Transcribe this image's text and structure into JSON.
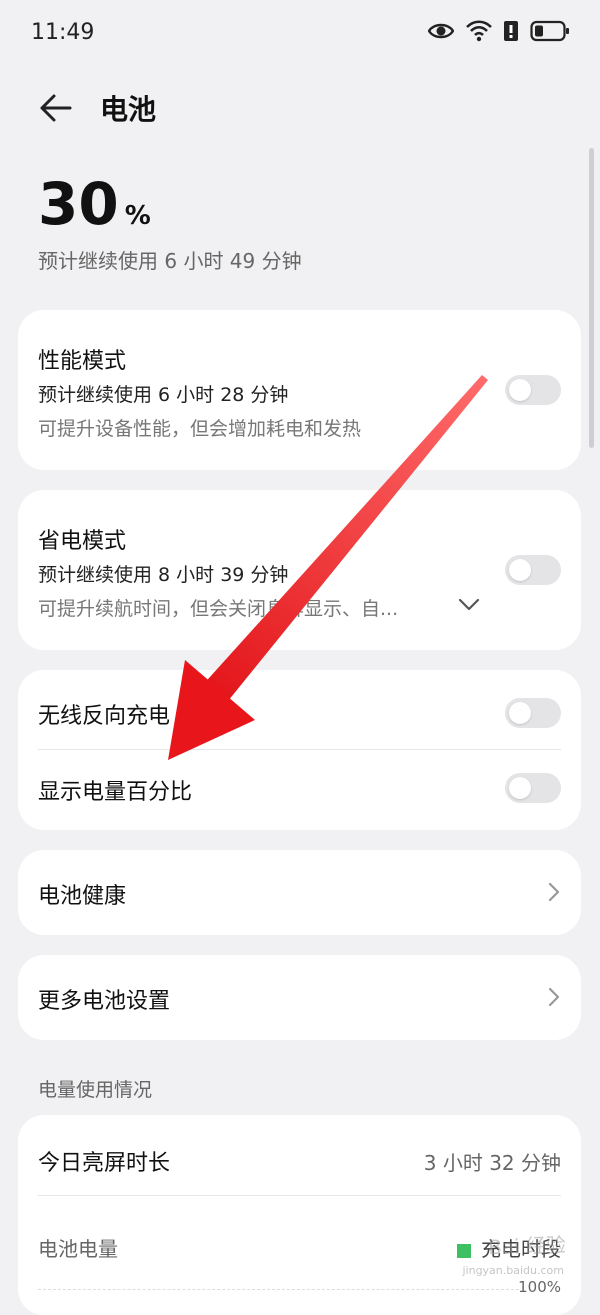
{
  "status_bar": {
    "time": "11:49",
    "icons": [
      "eye-icon",
      "wifi-icon",
      "alert-icon",
      "battery-icon"
    ]
  },
  "header": {
    "title": "电池",
    "back_icon": "arrow-left-icon"
  },
  "battery": {
    "percent": "30",
    "unit": "%",
    "estimate": "预计继续使用 6 小时 49 分钟"
  },
  "performance_mode": {
    "title": "性能模式",
    "estimate": "预计继续使用 6 小时 28 分钟",
    "desc": "可提升设备性能，但会增加耗电和发热",
    "enabled": false
  },
  "power_saving": {
    "title": "省电模式",
    "estimate": "预计继续使用 8 小时 39 分钟",
    "desc": "可提升续航时间，但会关闭息屏显示、自...",
    "enabled": false
  },
  "toggles": {
    "wireless_reverse": {
      "label": "无线反向充电",
      "enabled": false
    },
    "show_percent": {
      "label": "显示电量百分比",
      "enabled": false
    }
  },
  "links": {
    "battery_health": "电池健康",
    "more_settings": "更多电池设置"
  },
  "usage": {
    "section_label": "电量使用情况",
    "screen_time_label": "今日亮屏时长",
    "screen_time_value": "3 小时 32 分钟",
    "battery_level_label": "电池电量",
    "legend_label": "充电时段",
    "axis_top": "100%"
  },
  "colors": {
    "background": "#f1f1f3",
    "card": "#ffffff",
    "toggle_off": "#e4e4e7",
    "legend_green": "#3cc062",
    "annotation_arrow": "#e8161b"
  },
  "watermark": {
    "text": "Bai 经验",
    "sub": "jingyan.baidu.com"
  }
}
